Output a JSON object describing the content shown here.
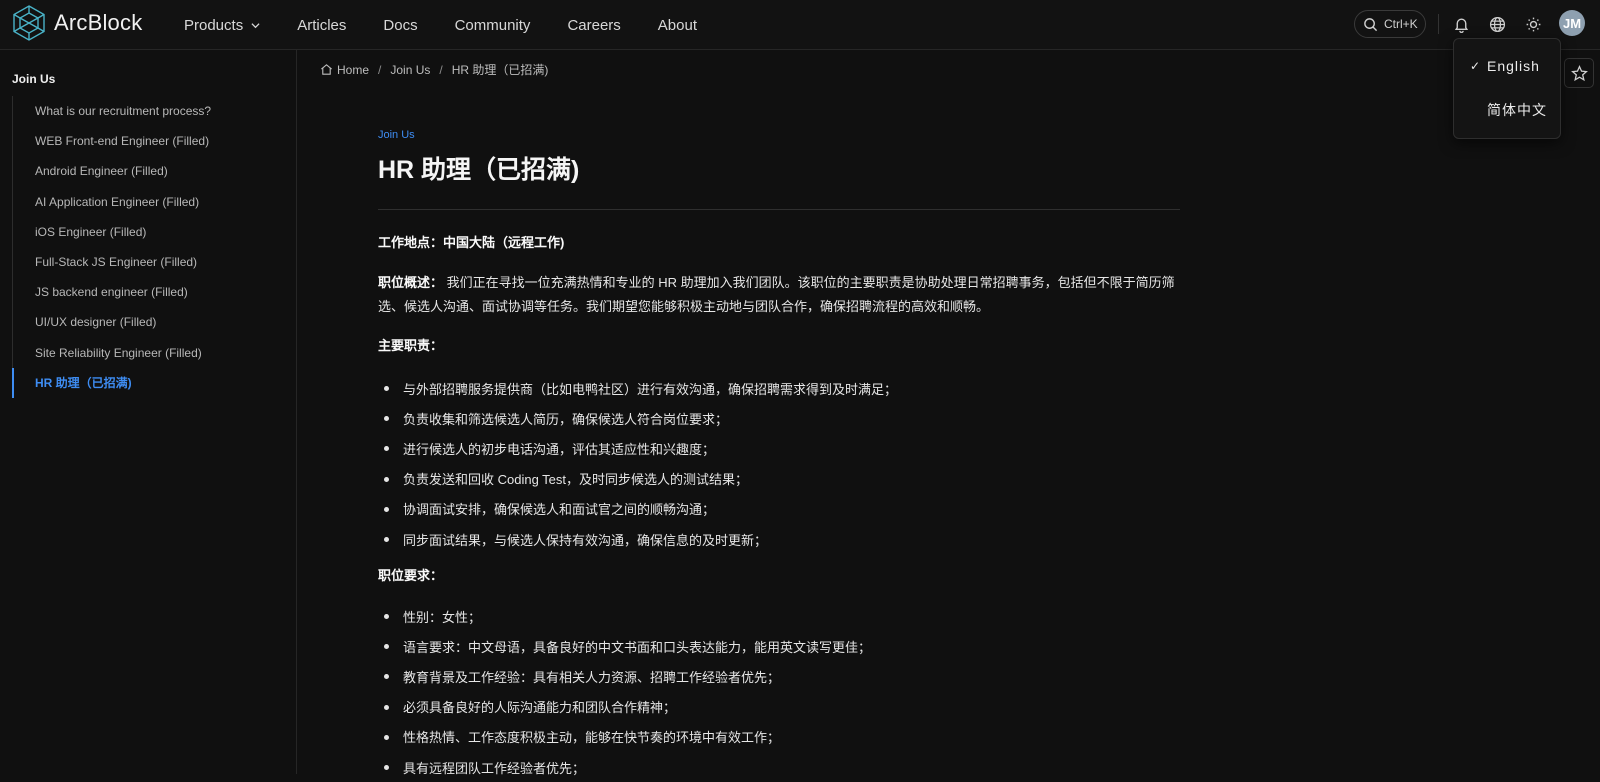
{
  "brand": {
    "name": "ArcBlock",
    "accent": "#3e8df3"
  },
  "nav": {
    "items": [
      {
        "label": "Products",
        "has_dropdown": true
      },
      {
        "label": "Articles"
      },
      {
        "label": "Docs"
      },
      {
        "label": "Community"
      },
      {
        "label": "Careers"
      },
      {
        "label": "About"
      }
    ]
  },
  "header": {
    "search_shortcut": "Ctrl+K",
    "avatar_initials": "JM",
    "icons": [
      "search-icon",
      "bell-icon",
      "globe-icon",
      "sun-icon"
    ]
  },
  "language_menu": {
    "items": [
      {
        "label": "English",
        "selected": true,
        "check": "✓"
      },
      {
        "label": "简体中文",
        "selected": false
      }
    ]
  },
  "sidebar": {
    "heading": "Join Us",
    "items": [
      {
        "label": "What is our recruitment process?"
      },
      {
        "label": "WEB Front-end Engineer (Filled)"
      },
      {
        "label": "Android Engineer (Filled)"
      },
      {
        "label": "AI Application Engineer (Filled)"
      },
      {
        "label": "iOS Engineer (Filled)"
      },
      {
        "label": "Full-Stack JS Engineer (Filled)"
      },
      {
        "label": "JS backend engineer (Filled)"
      },
      {
        "label": "UI/UX designer (Filled)"
      },
      {
        "label": "Site Reliability Engineer (Filled)"
      },
      {
        "label": "HR 助理（已招满)",
        "active": true
      }
    ]
  },
  "breadcrumb": {
    "items": [
      "Home",
      "Join Us",
      "HR 助理（已招满)"
    ],
    "separator": "/"
  },
  "article": {
    "eyebrow": "Join Us",
    "title": "HR 助理（已招满)",
    "location_label": "工作地点：",
    "location_value": "中国大陆（远程工作)",
    "overview_label": "职位概述：",
    "overview_text": " 我们正在寻找一位充满热情和专业的 HR 助理加入我们团队。该职位的主要职责是协助处理日常招聘事务，包括但不限于简历筛选、候选人沟通、面试协调等任务。我们期望您能够积极主动地与团队合作，确保招聘流程的高效和顺畅。",
    "duties_heading": "主要职责：",
    "duties": [
      "与外部招聘服务提供商（比如电鸭社区）进行有效沟通，确保招聘需求得到及时满足；",
      "负责收集和筛选候选人简历，确保候选人符合岗位要求；",
      "进行候选人的初步电话沟通，评估其适应性和兴趣度；",
      "负责发送和回收 Coding Test，及时同步候选人的测试结果；",
      "协调面试安排，确保候选人和面试官之间的顺畅沟通；",
      "同步面试结果，与候选人保持有效沟通，确保信息的及时更新；"
    ],
    "requirements_heading": "职位要求：",
    "requirements": [
      "性别：女性；",
      "语言要求：中文母语，具备良好的中文书面和口头表达能力，能用英文读写更佳；",
      "教育背景及工作经验：具有相关人力资源、招聘工作经验者优先；",
      "必须具备良好的人际沟通能力和团队合作精神；",
      "性格热情、工作态度积极主动，能够在快节奏的环境中有效工作；",
      "具有远程团队工作经验者优先；"
    ]
  }
}
